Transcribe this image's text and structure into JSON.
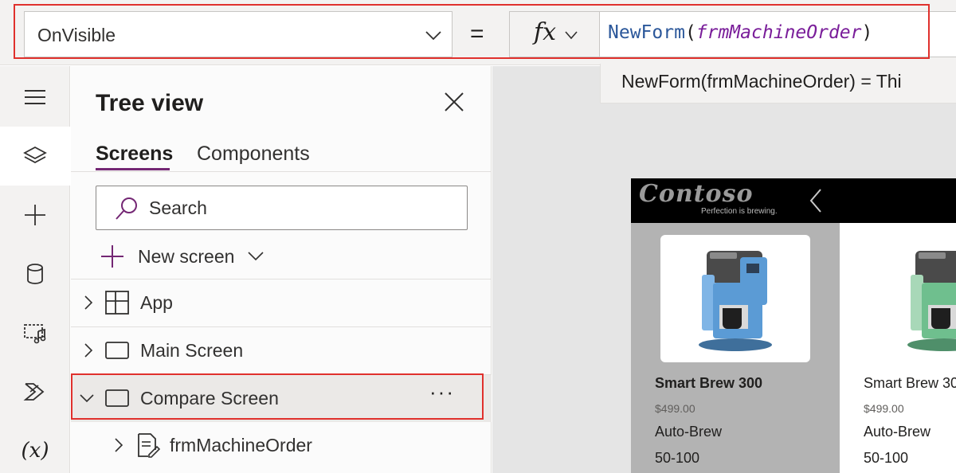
{
  "formula_bar": {
    "property": "OnVisible",
    "equals": "=",
    "fx_label": "fx",
    "formula_fn": "NewForm",
    "formula_open": "(",
    "formula_arg": "frmMachineOrder",
    "formula_close": ")",
    "tooltip": "NewForm(frmMachineOrder)  =  Thi"
  },
  "rail": {
    "items": [
      "hamburger-icon",
      "layers-icon",
      "plus-icon",
      "database-icon",
      "media-icon",
      "power-automate-icon",
      "variables-icon"
    ],
    "variables_label": "(x)"
  },
  "tree_view": {
    "title": "Tree view",
    "tabs": [
      {
        "label": "Screens",
        "active": true
      },
      {
        "label": "Components",
        "active": false
      }
    ],
    "search_placeholder": "Search",
    "new_screen_label": "New screen",
    "rows": [
      {
        "label": "App",
        "icon": "app-icon",
        "expanded": false
      },
      {
        "label": "Main Screen",
        "icon": "screen-icon",
        "expanded": false
      },
      {
        "label": "Compare Screen",
        "icon": "screen-icon",
        "expanded": true,
        "selected": true,
        "more": "···"
      },
      {
        "label": "frmMachineOrder",
        "icon": "form-icon",
        "expanded": false
      }
    ]
  },
  "canvas": {
    "logo": "Contoso",
    "tagline": "Perfection is brewing.",
    "products": [
      {
        "name": "Smart Brew 300",
        "price": "$499.00",
        "feature": "Auto-Brew",
        "capacity": "50-100",
        "color": "#5b9bd5"
      },
      {
        "name": "Smart Brew 30",
        "price": "$499.00",
        "feature": "Auto-Brew",
        "capacity": "50-100",
        "color": "#6fbf8e"
      }
    ]
  },
  "colors": {
    "accent": "#742774",
    "highlight_border": "#e0312d",
    "formula_function": "#2b579a",
    "formula_argument": "#7a1e9a"
  }
}
